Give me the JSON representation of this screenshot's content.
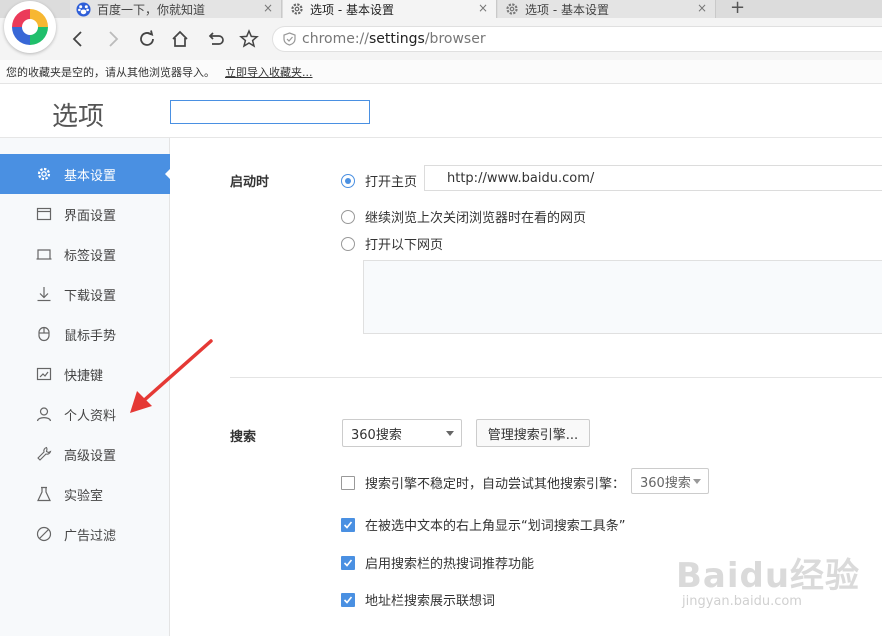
{
  "browser": {
    "tabs": [
      {
        "title": "百度一下，你就知道",
        "icon": "baidu-paw-icon",
        "close": "×"
      },
      {
        "title": "选项 - 基本设置",
        "icon": "gear-icon",
        "close": "×"
      },
      {
        "title": "选项 - 基本设置",
        "icon": "gear-icon",
        "close": "×"
      }
    ],
    "new_tab": "+",
    "address": {
      "scheme": "chrome://",
      "host": "settings",
      "path": "/browser"
    },
    "bookmarks_bar": {
      "message": "您的收藏夹是空的，请从其他浏览器导入。",
      "import_link": "立即导入收藏夹..."
    }
  },
  "page": {
    "title": "选项",
    "search_value": ""
  },
  "sidebar": {
    "items": [
      {
        "label": "基本设置",
        "icon": "gear-icon",
        "active": true
      },
      {
        "label": "界面设置",
        "icon": "window-icon"
      },
      {
        "label": "标签设置",
        "icon": "tab-icon"
      },
      {
        "label": "下载设置",
        "icon": "download-icon"
      },
      {
        "label": "鼠标手势",
        "icon": "mouse-icon"
      },
      {
        "label": "快捷键",
        "icon": "keyboard-icon"
      },
      {
        "label": "个人资料",
        "icon": "user-icon"
      },
      {
        "label": "高级设置",
        "icon": "wrench-icon"
      },
      {
        "label": "实验室",
        "icon": "flask-icon"
      },
      {
        "label": "广告过滤",
        "icon": "block-icon"
      }
    ]
  },
  "startup": {
    "label": "启动时",
    "options": [
      {
        "label": "打开主页",
        "selected": true
      },
      {
        "label": "继续浏览上次关闭浏览器时在看的网页",
        "selected": false
      },
      {
        "label": "打开以下网页",
        "selected": false
      }
    ],
    "home_url": "http://www.baidu.com/"
  },
  "search": {
    "label": "搜索",
    "engine": "360搜索",
    "manage_button": "管理搜索引擎...",
    "fallback_label": "搜索引擎不稳定时，自动尝试其他搜索引擎：",
    "fallback_engine": "360搜索",
    "fallback_checked": false,
    "options": [
      {
        "label": "在被选中文本的右上角显示“划词搜索工具条”",
        "checked": true
      },
      {
        "label": "启用搜索栏的热搜词推荐功能",
        "checked": true
      },
      {
        "label": "地址栏搜索展示联想词",
        "checked": true
      }
    ]
  },
  "watermark": {
    "main": "Baidu经验",
    "sub": "jingyan.baidu.com"
  },
  "colors": {
    "accent": "#4a90e2",
    "annotation_arrow": "#e53935"
  }
}
